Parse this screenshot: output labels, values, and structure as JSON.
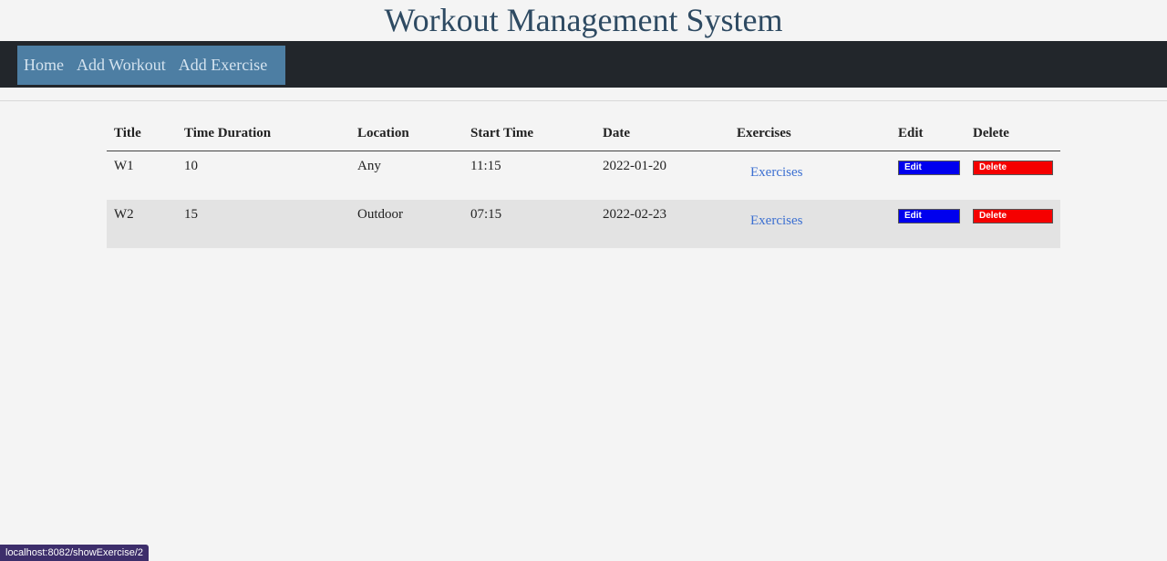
{
  "site": {
    "title": "Workout Management System"
  },
  "nav": {
    "items": [
      {
        "label": "Home"
      },
      {
        "label": "Add Workout"
      },
      {
        "label": "Add Exercise"
      }
    ]
  },
  "table": {
    "headers": [
      "Title",
      "Time Duration",
      "Location",
      "Start Time",
      "Date",
      "Exercises",
      "Edit",
      "Delete"
    ],
    "rows": [
      {
        "title": "W1",
        "duration": "10",
        "location": "Any",
        "start_time": "11:15",
        "date": "2022-01-20",
        "exercises_link": "Exercises",
        "edit_label": "Edit",
        "delete_label": "Delete"
      },
      {
        "title": "W2",
        "duration": "15",
        "location": "Outdoor",
        "start_time": "07:15",
        "date": "2022-02-23",
        "exercises_link": "Exercises",
        "edit_label": "Edit",
        "delete_label": "Delete"
      }
    ]
  },
  "status_bar": {
    "url": "localhost:8082/showExercise/2"
  },
  "colors": {
    "title": "#2e4a62",
    "navbar": "#22262b",
    "nav_group": "#4d7ea3",
    "edit_button": "#0000ee",
    "delete_button": "#f50000",
    "link": "#3b6fd1"
  }
}
